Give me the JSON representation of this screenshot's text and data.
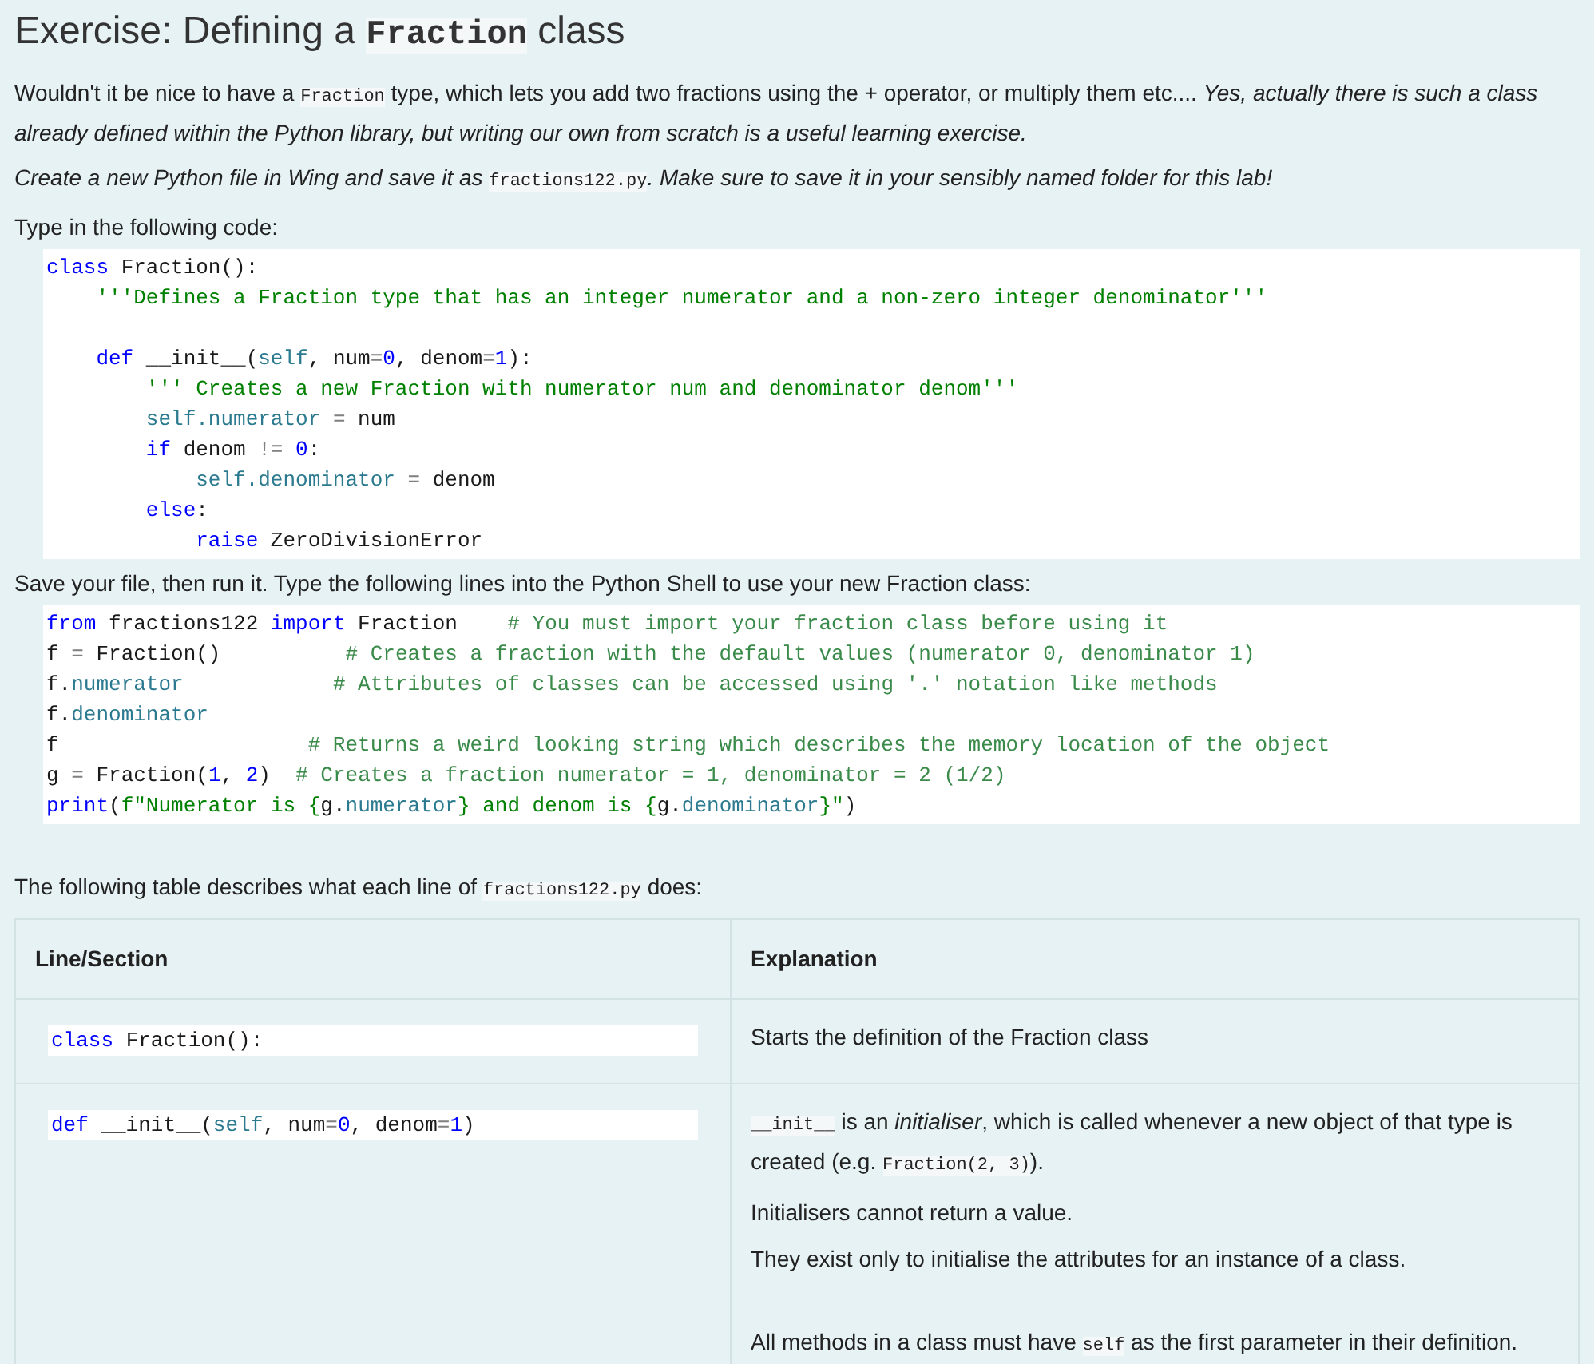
{
  "title": [
    {
      "kind": "text",
      "text": "Exercise: Defining a "
    },
    {
      "kind": "code",
      "text": "Fraction"
    },
    {
      "kind": "text",
      "text": " class"
    }
  ],
  "paragraphs_top": [
    [
      {
        "kind": "text",
        "text": "Wouldn't it be nice to have a "
      },
      {
        "kind": "code",
        "text": "Fraction"
      },
      {
        "kind": "text",
        "text": " type, which lets you add two fractions using the + operator, or multiply them etc.... "
      },
      {
        "kind": "italic",
        "text": "Yes, actually there is such a class already defined within the Python library, but writing our own from scratch is a useful learning exercise."
      }
    ],
    [
      {
        "kind": "italic",
        "text": "Create a new Python file in Wing and save it as "
      },
      {
        "kind": "code",
        "text": "fractions122.py"
      },
      {
        "kind": "italic",
        "text": ". Make sure to save it in your sensibly named folder for this lab!"
      }
    ],
    [
      {
        "kind": "text",
        "text": "Type in the following code:"
      }
    ]
  ],
  "code_block_1": [
    {
      "kind": "code",
      "tokens": [
        {
          "kind": "kw",
          "text": "class"
        },
        {
          "kind": "plain",
          "text": " Fraction():"
        }
      ]
    },
    {
      "kind": "code",
      "tokens": [
        {
          "kind": "str",
          "text": "    '''Defines a Fraction type that has an integer numerator and a non-zero integer denominator'''"
        }
      ]
    },
    {
      "kind": "blank"
    },
    {
      "kind": "code",
      "tokens": [
        {
          "kind": "kw",
          "text": "    def"
        },
        {
          "kind": "plain",
          "text": " __init__("
        },
        {
          "kind": "self",
          "text": "self"
        },
        {
          "kind": "plain",
          "text": ", num"
        },
        {
          "kind": "op",
          "text": "="
        },
        {
          "kind": "num",
          "text": "0"
        },
        {
          "kind": "plain",
          "text": ", denom"
        },
        {
          "kind": "op",
          "text": "="
        },
        {
          "kind": "num",
          "text": "1"
        },
        {
          "kind": "plain",
          "text": "):"
        }
      ]
    },
    {
      "kind": "code",
      "tokens": [
        {
          "kind": "str",
          "text": "        ''' Creates a new Fraction with numerator num and denominator denom'''"
        }
      ]
    },
    {
      "kind": "code",
      "tokens": [
        {
          "kind": "self",
          "text": "        self.numerator"
        },
        {
          "kind": "op",
          "text": " = "
        },
        {
          "kind": "plain",
          "text": "num"
        }
      ]
    },
    {
      "kind": "code",
      "tokens": [
        {
          "kind": "kw",
          "text": "        if"
        },
        {
          "kind": "plain",
          "text": " denom"
        },
        {
          "kind": "op",
          "text": " != "
        },
        {
          "kind": "num",
          "text": "0"
        },
        {
          "kind": "plain",
          "text": ":"
        }
      ]
    },
    {
      "kind": "code",
      "tokens": [
        {
          "kind": "self",
          "text": "            self.denominator"
        },
        {
          "kind": "op",
          "text": " = "
        },
        {
          "kind": "plain",
          "text": "denom"
        }
      ]
    },
    {
      "kind": "code",
      "tokens": [
        {
          "kind": "kw",
          "text": "        else"
        },
        {
          "kind": "plain",
          "text": ":"
        }
      ]
    },
    {
      "kind": "code",
      "tokens": [
        {
          "kind": "kw",
          "text": "            raise"
        },
        {
          "kind": "plain",
          "text": " ZeroDivisionError"
        }
      ]
    }
  ],
  "paragraph_middle": [
    {
      "kind": "text",
      "text": "Save your file, then run it. Type the following lines into the Python Shell to use your new Fraction class:"
    }
  ],
  "code_block_2": [
    {
      "kind": "code",
      "tokens": [
        {
          "kind": "kw",
          "text": "from"
        },
        {
          "kind": "plain",
          "text": " fractions122 "
        },
        {
          "kind": "kw",
          "text": "import"
        },
        {
          "kind": "plain",
          "text": " Fraction    "
        },
        {
          "kind": "com",
          "text": "# You must import your fraction class before using it"
        }
      ]
    },
    {
      "kind": "code",
      "tokens": [
        {
          "kind": "plain",
          "text": "f"
        },
        {
          "kind": "op",
          "text": " = "
        },
        {
          "kind": "plain",
          "text": "Fraction()          "
        },
        {
          "kind": "com",
          "text": "# Creates a fraction with the default values (numerator 0, denominator 1)"
        }
      ]
    },
    {
      "kind": "code",
      "tokens": [
        {
          "kind": "plain",
          "text": "f."
        },
        {
          "kind": "self",
          "text": "numerator"
        },
        {
          "kind": "com",
          "text": "            # Attributes of classes can be accessed using '.' notation like methods"
        }
      ]
    },
    {
      "kind": "code",
      "tokens": [
        {
          "kind": "plain",
          "text": "f."
        },
        {
          "kind": "self",
          "text": "denominator"
        }
      ]
    },
    {
      "kind": "code",
      "tokens": [
        {
          "kind": "plain",
          "text": "f                    "
        },
        {
          "kind": "com",
          "text": "# Returns a weird looking string which describes the memory location of the object"
        }
      ]
    },
    {
      "kind": "code",
      "tokens": [
        {
          "kind": "plain",
          "text": "g"
        },
        {
          "kind": "op",
          "text": " = "
        },
        {
          "kind": "plain",
          "text": "Fraction("
        },
        {
          "kind": "num",
          "text": "1"
        },
        {
          "kind": "plain",
          "text": ", "
        },
        {
          "kind": "num",
          "text": "2"
        },
        {
          "kind": "plain",
          "text": ")  "
        },
        {
          "kind": "com",
          "text": "# Creates a fraction numerator = 1, denominator = 2 (1/2)"
        }
      ]
    },
    {
      "kind": "code",
      "tokens": [
        {
          "kind": "kw",
          "text": "print"
        },
        {
          "kind": "plain",
          "text": "("
        },
        {
          "kind": "str",
          "text": "f\"Numerator is {"
        },
        {
          "kind": "plain",
          "text": "g."
        },
        {
          "kind": "self",
          "text": "numerator"
        },
        {
          "kind": "str",
          "text": "} and denom is {"
        },
        {
          "kind": "plain",
          "text": "g."
        },
        {
          "kind": "self",
          "text": "denominator"
        },
        {
          "kind": "str",
          "text": "}\""
        },
        {
          "kind": "plain",
          "text": ")"
        }
      ]
    }
  ],
  "paragraph_table_intro": [
    {
      "kind": "text",
      "text": "The following table describes what each line of "
    },
    {
      "kind": "code",
      "text": "fractions122.py"
    },
    {
      "kind": "text",
      "text": " does:"
    }
  ],
  "table": {
    "columns": [
      "Line/Section",
      "Explanation"
    ],
    "rows": [
      {
        "code": [
          {
            "kind": "kw",
            "text": "class"
          },
          {
            "kind": "plain",
            "text": " Fraction():"
          }
        ],
        "explanation": [
          {
            "kind": "paragraph",
            "segments": [
              {
                "kind": "text",
                "text": "Starts the definition of the Fraction class"
              }
            ]
          }
        ]
      },
      {
        "code": [
          {
            "kind": "kw",
            "text": "def"
          },
          {
            "kind": "plain",
            "text": " __init__("
          },
          {
            "kind": "self",
            "text": "self"
          },
          {
            "kind": "plain",
            "text": ", num"
          },
          {
            "kind": "op",
            "text": "="
          },
          {
            "kind": "num",
            "text": "0"
          },
          {
            "kind": "plain",
            "text": ", denom"
          },
          {
            "kind": "op",
            "text": "="
          },
          {
            "kind": "num",
            "text": "1"
          },
          {
            "kind": "plain",
            "text": ")"
          }
        ],
        "explanation": [
          {
            "kind": "paragraph",
            "segments": [
              {
                "kind": "code",
                "text": "__init__"
              },
              {
                "kind": "text",
                "text": " is an "
              },
              {
                "kind": "italic",
                "text": "initialiser"
              },
              {
                "kind": "text",
                "text": ", which is called whenever a new object of that type is created (e.g. "
              },
              {
                "kind": "code",
                "text": "Fraction(2, 3)"
              },
              {
                "kind": "text",
                "text": ")."
              }
            ]
          },
          {
            "kind": "paragraph",
            "segments": [
              {
                "kind": "text",
                "text": "Initialisers cannot return a value."
              }
            ]
          },
          {
            "kind": "paragraph",
            "segments": [
              {
                "kind": "text",
                "text": "They exist only to initialise the attributes for an instance of a class."
              }
            ]
          },
          {
            "kind": "gap"
          },
          {
            "kind": "paragraph",
            "segments": [
              {
                "kind": "text",
                "text": "All methods in a class must have "
              },
              {
                "kind": "code",
                "text": "self"
              },
              {
                "kind": "text",
                "text": " as the first parameter in their definition."
              }
            ]
          }
        ]
      }
    ]
  }
}
